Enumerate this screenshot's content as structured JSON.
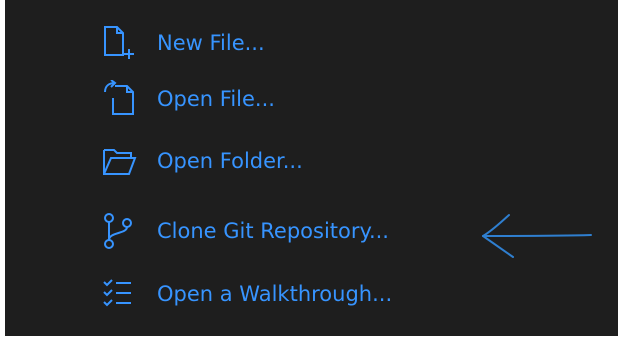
{
  "start": {
    "items": [
      {
        "label": "New File...",
        "icon": "new-file-icon"
      },
      {
        "label": "Open File...",
        "icon": "open-file-icon"
      },
      {
        "label": "Open Folder...",
        "icon": "open-folder-icon"
      },
      {
        "label": "Clone Git Repository...",
        "icon": "source-control-icon"
      },
      {
        "label": "Open a Walkthrough...",
        "icon": "checklist-icon"
      }
    ]
  },
  "annotation": {
    "arrow_icon": "left-arrow-icon",
    "color": "#2f7fd0"
  },
  "colors": {
    "background": "#1e1e1e",
    "link": "#3794ff",
    "page": "#ffffff"
  }
}
